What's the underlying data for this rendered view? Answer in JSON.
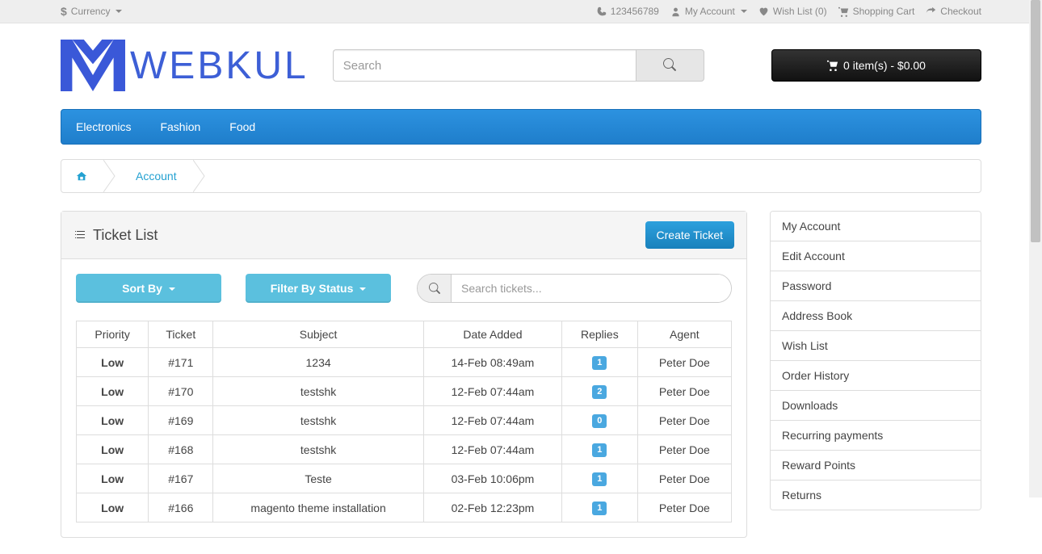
{
  "topbar": {
    "currency_label": "Currency",
    "phone": "123456789",
    "account_label": "My Account",
    "wishlist_label": "Wish List (0)",
    "cart_label": "Shopping Cart",
    "checkout_label": "Checkout"
  },
  "logo_text": "WEBKUL",
  "search": {
    "placeholder": "Search"
  },
  "cart_button": "0 item(s) - $0.00",
  "nav": {
    "items": [
      "Electronics",
      "Fashion",
      "Food"
    ]
  },
  "breadcrumb": {
    "account": "Account"
  },
  "panel": {
    "title": "Ticket List",
    "create_btn": "Create Ticket",
    "sort_btn": "Sort By",
    "filter_btn": "Filter By Status",
    "search_placeholder": "Search tickets..."
  },
  "table": {
    "headers": {
      "priority": "Priority",
      "ticket": "Ticket",
      "subject": "Subject",
      "date": "Date Added",
      "replies": "Replies",
      "agent": "Agent"
    },
    "rows": [
      {
        "priority": "Low",
        "ticket": "#171",
        "subject": "1234",
        "date": "14-Feb 08:49am",
        "replies": "1",
        "agent": "Peter Doe"
      },
      {
        "priority": "Low",
        "ticket": "#170",
        "subject": "testshk",
        "date": "12-Feb 07:44am",
        "replies": "2",
        "agent": "Peter Doe"
      },
      {
        "priority": "Low",
        "ticket": "#169",
        "subject": "testshk",
        "date": "12-Feb 07:44am",
        "replies": "0",
        "agent": "Peter Doe"
      },
      {
        "priority": "Low",
        "ticket": "#168",
        "subject": "testshk",
        "date": "12-Feb 07:44am",
        "replies": "1",
        "agent": "Peter Doe"
      },
      {
        "priority": "Low",
        "ticket": "#167",
        "subject": "Teste",
        "date": "03-Feb 10:06pm",
        "replies": "1",
        "agent": "Peter Doe"
      },
      {
        "priority": "Low",
        "ticket": "#166",
        "subject": "magento theme installation",
        "date": "02-Feb 12:23pm",
        "replies": "1",
        "agent": "Peter Doe"
      }
    ]
  },
  "side": {
    "items": [
      "My Account",
      "Edit Account",
      "Password",
      "Address Book",
      "Wish List",
      "Order History",
      "Downloads",
      "Recurring payments",
      "Reward Points",
      "Returns"
    ]
  }
}
